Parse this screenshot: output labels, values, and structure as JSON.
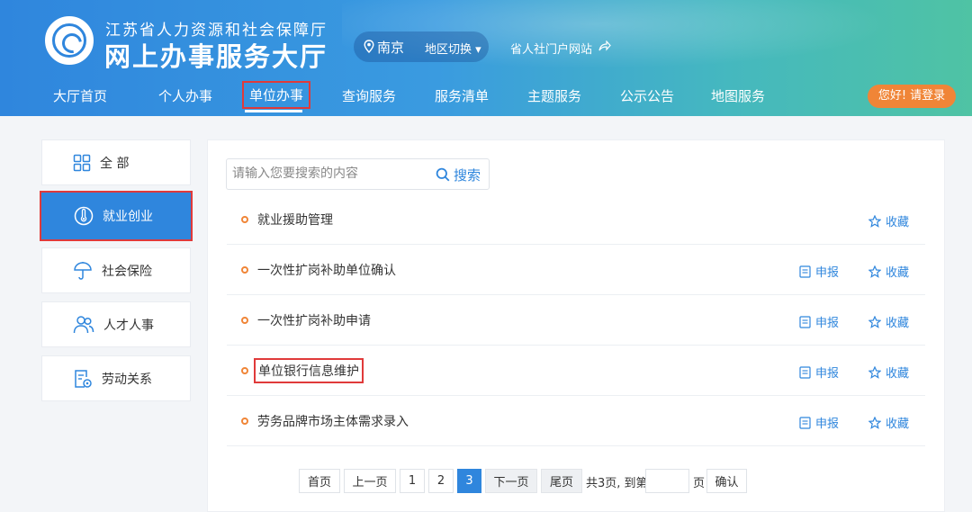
{
  "header": {
    "org_name": "江苏省人力资源和社会保障厅",
    "site_name": "网上办事服务大厅",
    "city": "南京",
    "region_switch": "地区切换 ▾",
    "portal_link": "省人社门户网站",
    "login": "您好! 请登录"
  },
  "nav": [
    "大厅首页",
    "个人办事",
    "单位办事",
    "查询服务",
    "服务清单",
    "主题服务",
    "公示公告",
    "地图服务"
  ],
  "sidebar": [
    "全 部",
    "就业创业",
    "社会保险",
    "人才人事",
    "劳动关系"
  ],
  "search": {
    "placeholder": "请输入您要搜索的内容",
    "button": "搜索"
  },
  "items": [
    {
      "title": "就业援助管理",
      "apply": "",
      "fav": "收藏"
    },
    {
      "title": "一次性扩岗补助单位确认",
      "apply": "申报",
      "fav": "收藏"
    },
    {
      "title": "一次性扩岗补助申请",
      "apply": "申报",
      "fav": "收藏"
    },
    {
      "title": "单位银行信息维护",
      "apply": "申报",
      "fav": "收藏"
    },
    {
      "title": "劳务品牌市场主体需求录入",
      "apply": "申报",
      "fav": "收藏"
    }
  ],
  "pagination": {
    "first": "首页",
    "prev": "上一页",
    "pages": [
      "1",
      "2",
      "3"
    ],
    "next": "下一页",
    "last": "尾页",
    "total": "共3页, 到第",
    "page_unit": "页",
    "confirm": "确认"
  },
  "colors": {
    "primary": "#2f86dd",
    "accent": "#f08537",
    "highlight": "#e03a3a"
  }
}
